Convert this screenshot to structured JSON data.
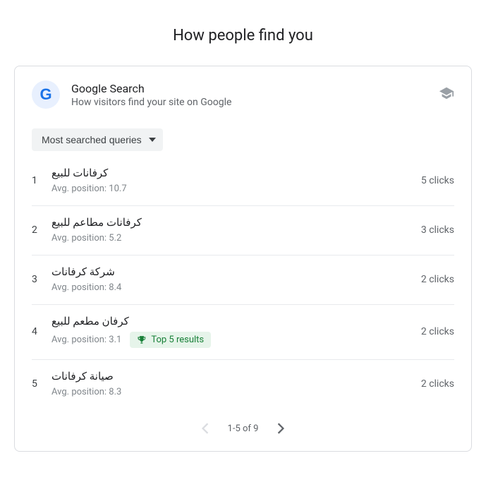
{
  "page_title": "How people find you",
  "card": {
    "title": "Google Search",
    "subtitle": "How visitors find your site on Google"
  },
  "filter": {
    "label": "Most searched queries"
  },
  "avg_position_prefix": "Avg. position: ",
  "badge_text": "Top 5 results",
  "queries": [
    {
      "rank": "1",
      "text": "كرفانات للبيع",
      "position": "10.7",
      "clicks": "5 clicks",
      "badge": false
    },
    {
      "rank": "2",
      "text": "كرفانات مطاعم للبيع",
      "position": "5.2",
      "clicks": "3 clicks",
      "badge": false
    },
    {
      "rank": "3",
      "text": "شركة كرفانات",
      "position": "8.4",
      "clicks": "2 clicks",
      "badge": false
    },
    {
      "rank": "4",
      "text": "كرفان مطعم للبيع",
      "position": "3.1",
      "clicks": "2 clicks",
      "badge": true
    },
    {
      "rank": "5",
      "text": "صيانة كرفانات",
      "position": "8.3",
      "clicks": "2 clicks",
      "badge": false
    }
  ],
  "pagination": {
    "range": "1-5 of 9"
  }
}
